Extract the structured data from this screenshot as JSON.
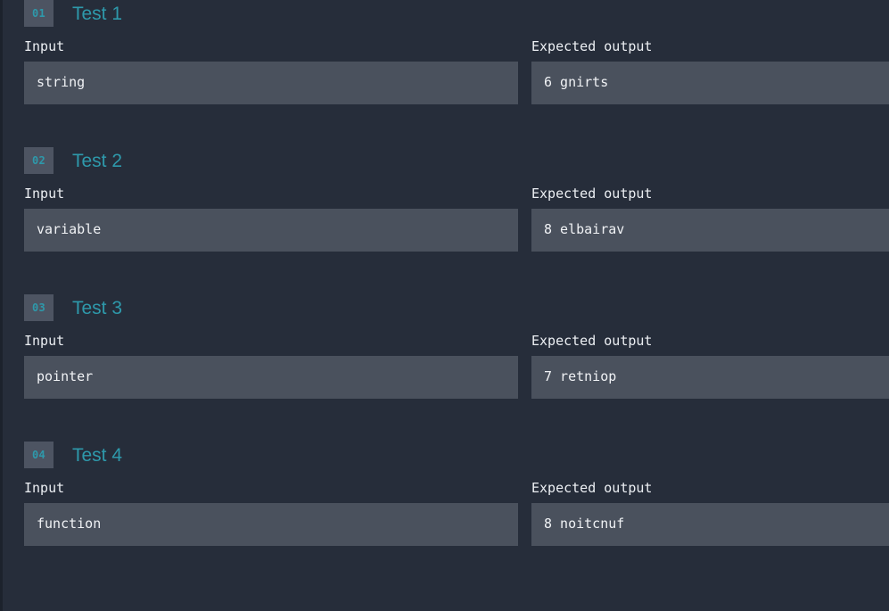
{
  "panel": {
    "input_label": "Input",
    "expected_output_label": "Expected output",
    "accent_color": "#2e99ab",
    "background_color": "#262d3a",
    "field_color": "#4a515d",
    "badge_color": "#4d5462"
  },
  "tests": [
    {
      "index": "01",
      "title": "Test 1",
      "input_label": "Input",
      "input": "string",
      "output_label": "Expected output",
      "expected_output": "6 gnirts"
    },
    {
      "index": "02",
      "title": "Test 2",
      "input_label": "Input",
      "input": "variable",
      "output_label": "Expected output",
      "expected_output": "8 elbairav"
    },
    {
      "index": "03",
      "title": "Test 3",
      "input_label": "Input",
      "input": "pointer",
      "output_label": "Expected output",
      "expected_output": "7 retniop"
    },
    {
      "index": "04",
      "title": "Test 4",
      "input_label": "Input",
      "input": "function",
      "output_label": "Expected output",
      "expected_output": "8 noitcnuf"
    }
  ]
}
